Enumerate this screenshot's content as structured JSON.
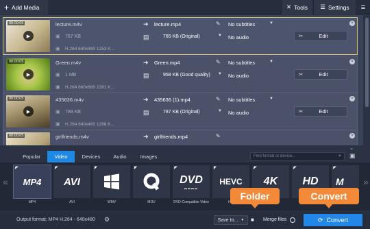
{
  "topbar": {
    "add_media": "Add Media",
    "tools": "Tools",
    "settings": "Settings"
  },
  "files": [
    {
      "duration": "00:00:05",
      "src_name": "lecture.m4v",
      "src_size": "767 KB",
      "src_info": "H.264 640x480 1253 K...",
      "out_name": "lecture.mp4",
      "out_size": "765 KB (Original)",
      "subtitles": "No subtitles",
      "audio": "No audio",
      "edit": "Edit",
      "thumb_color": "#c7b78e"
    },
    {
      "duration": "00:00:05",
      "src_name": "Green.m4v",
      "src_size": "1 MB",
      "src_info": "H.264 860x680 2281 K...",
      "out_name": "Green.mp4",
      "out_size": "958 KB (Good quality)",
      "subtitles": "No subtitles",
      "audio": "No audio",
      "edit": "Edit",
      "thumb_color": "#6e9d2c"
    },
    {
      "duration": "00:00:05",
      "src_name": "435636.m4v",
      "src_size": "788 KB",
      "src_info": "H.264 640x480 1288 K...",
      "out_name": "435636 (1).mp4",
      "out_size": "787 KB (Original)",
      "subtitles": "No subtitles",
      "audio": "No audio",
      "edit": "Edit",
      "thumb_color": "#9c8a63"
    },
    {
      "duration": "00:00:05",
      "src_name": "girlfriends.m4v",
      "src_size": "",
      "src_info": "",
      "out_name": "girlfriends.mp4",
      "out_size": "",
      "subtitles": "",
      "audio": "",
      "edit": "",
      "thumb_color": "#b8a77e"
    }
  ],
  "tabs": [
    "Popular",
    "Video",
    "Devices",
    "Audio",
    "Images"
  ],
  "active_tab": "Video",
  "search_placeholder": "Find format or device...",
  "formats": [
    {
      "logo": "MP4",
      "label": "MP4",
      "active": true
    },
    {
      "logo": "AVI",
      "label": "AVI",
      "active": false
    },
    {
      "logo": "WMV",
      "label": "WMV",
      "active": false
    },
    {
      "logo": "MOV",
      "label": "MOV",
      "active": false
    },
    {
      "logo": "DVD",
      "label": "DVD-Compatible Video",
      "active": false
    },
    {
      "logo": "HEVC",
      "label": "H...",
      "active": false
    },
    {
      "logo": "4K",
      "label": "",
      "active": false
    },
    {
      "logo": "HD",
      "label": "HD",
      "active": false
    },
    {
      "logo": "M",
      "label": "",
      "active": false
    }
  ],
  "bottom": {
    "output_format": "Output format: MP4 H.264 - 640x480",
    "save_to": "Save to...",
    "merge_files": "Merge files",
    "convert": "Convert"
  },
  "callouts": {
    "folder": "Folder",
    "convert": "Convert"
  },
  "colors": {
    "accent_blue": "#2287e6",
    "callout_orange": "#f28a3a",
    "selected_border": "#d7c26a"
  }
}
